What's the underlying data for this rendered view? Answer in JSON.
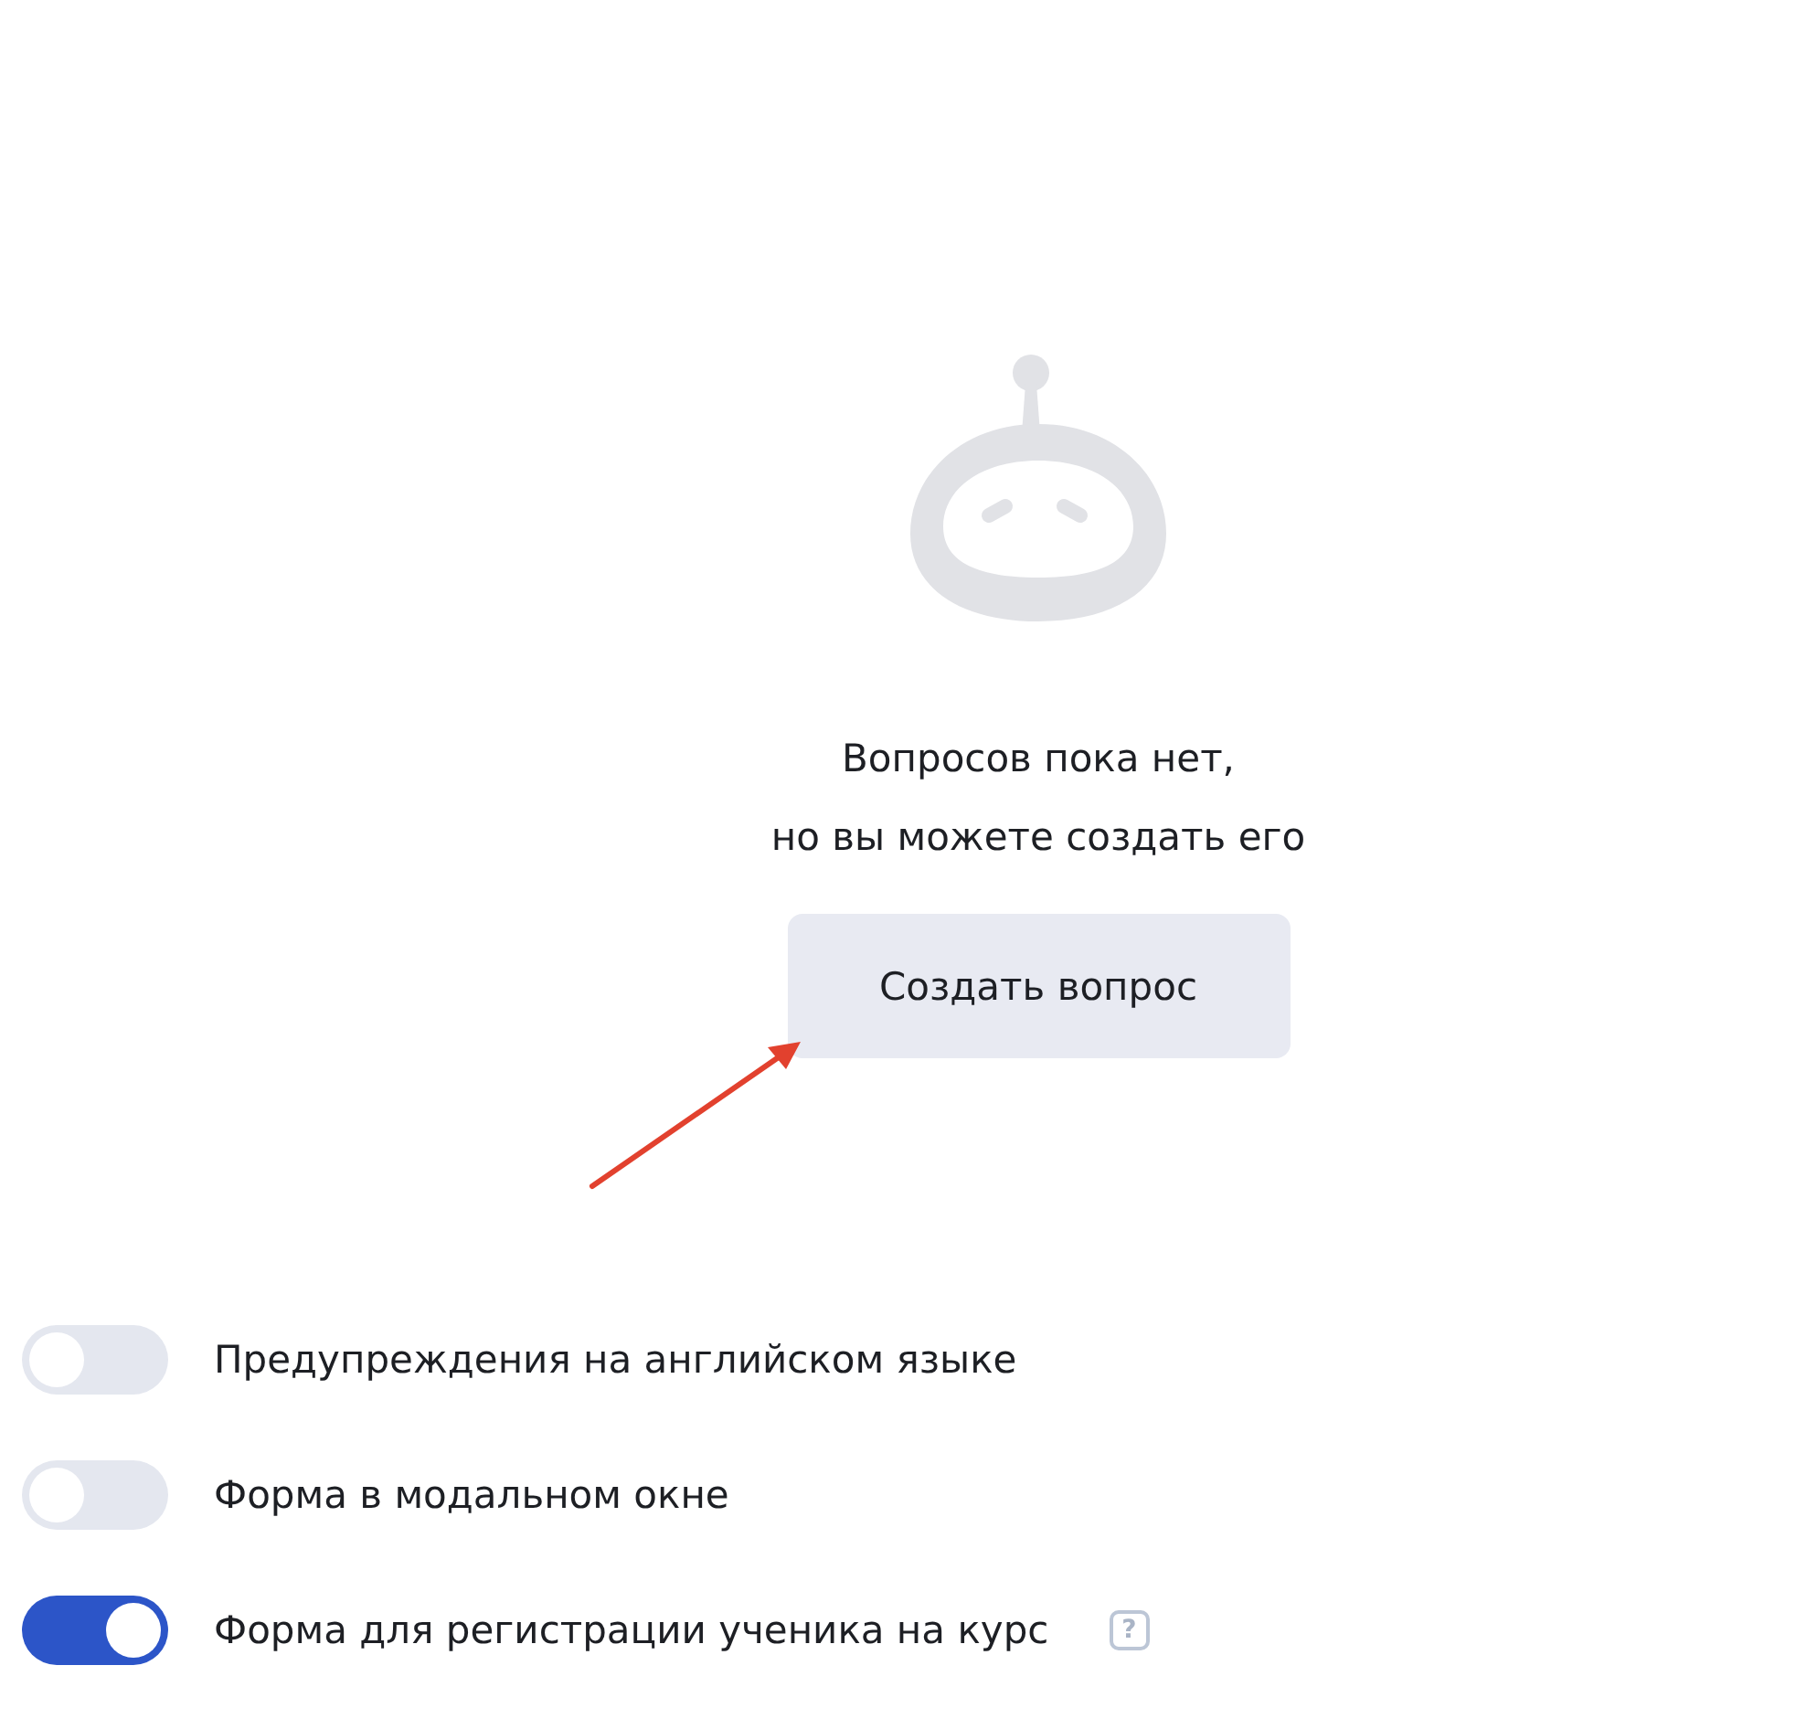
{
  "empty_state": {
    "message_lines": [
      "Вопросов пока нет,",
      "но вы можете создать его"
    ],
    "button": "Создать вопрос"
  },
  "settings": [
    {
      "label": "Предупреждения на английском языке",
      "on": false
    },
    {
      "label": "Форма в модальном окне",
      "on": false
    },
    {
      "label": "Форма для регистрации ученика на курс",
      "on": true,
      "help": "?"
    }
  ]
}
